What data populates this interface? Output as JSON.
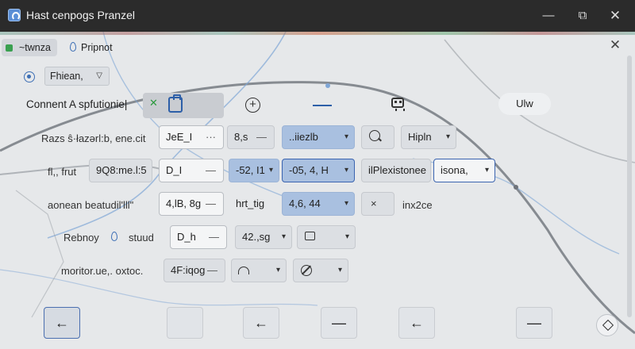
{
  "window": {
    "title": "Hast cenpogs Pranzel",
    "minimize": "—",
    "maximize": "⧉",
    "close": "✕"
  },
  "tabs": [
    {
      "label": "~twnza",
      "active": true
    },
    {
      "label": "Pripnot",
      "active": false
    }
  ],
  "panel_close": "✕",
  "filter": {
    "value": "Fhiean,"
  },
  "toolbar": {
    "label": "Connent A spfutionie|",
    "x_mark": "✕",
    "plus": "+",
    "pill": "Ulw"
  },
  "rows": [
    {
      "label": "Razs ŝ·łazərl:b, ene.cit",
      "controls": [
        {
          "text": "JeE_I",
          "suffix": "···"
        },
        {
          "text": "8,s",
          "suffix": "—"
        },
        {
          "text": "..iiezlb",
          "suffix": "▾"
        },
        {
          "text": "",
          "icon": "search-icon"
        },
        {
          "text": "Hipln",
          "suffix": "▾"
        }
      ]
    },
    {
      "label": "fl,, frut",
      "controls": [
        {
          "text": "9Q8:me.l:5"
        },
        {
          "text": "D_I",
          "suffix": "—"
        },
        {
          "text": "-52, I1",
          "suffix": "▾"
        },
        {
          "text": "-05, 4, H",
          "suffix": "▾"
        },
        {
          "text": "ilPlexistonee"
        },
        {
          "text": "isona,",
          "suffix": "▾"
        }
      ]
    },
    {
      "label": "aonean beatudil'lll\"",
      "controls": [
        {
          "text": "4,lB, 8g",
          "suffix": "—"
        },
        {
          "text": "hrt_tig"
        },
        {
          "text": "4,6, 44",
          "suffix": "▾"
        },
        {
          "text": "×",
          "icon": "close-icon"
        },
        {
          "text": "inx2ce"
        }
      ]
    },
    {
      "label": "Rebnoy",
      "label2": "stuud",
      "controls": [
        {
          "text": "D_h",
          "suffix": "—"
        },
        {
          "text": "42.,sg",
          "suffix": "▾"
        },
        {
          "text": "",
          "icon": "chat-icon",
          "suffix": "▾"
        }
      ]
    },
    {
      "label": "moritor.ue,. oxtoc.",
      "controls": [
        {
          "text": "4F:iqog",
          "suffix": "—"
        },
        {
          "text": "",
          "icon": "arch-icon",
          "suffix": "▾"
        },
        {
          "text": "",
          "icon": "hand-icon",
          "suffix": "▾"
        }
      ]
    }
  ],
  "bottom_buttons": [
    {
      "glyph": "←",
      "selected": true
    },
    {
      "glyph": ""
    },
    {
      "glyph": "←"
    },
    {
      "glyph": "—"
    },
    {
      "glyph": "←"
    },
    {
      "glyph": "—"
    }
  ],
  "colors": {
    "titlebar": "#2b2b2b",
    "accent": "#3b64b0",
    "highlight": "#a9c0e0",
    "success": "#2b9a3e"
  }
}
